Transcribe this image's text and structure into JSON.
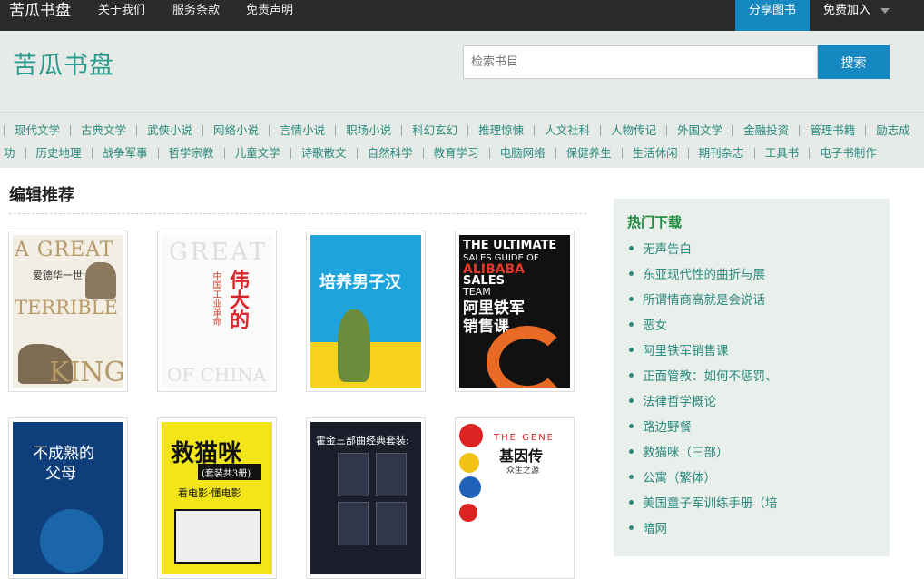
{
  "topbar": {
    "brand": "苦瓜书盘",
    "nav": [
      "关于我们",
      "服务条款",
      "免责声明"
    ],
    "share": "分享图书",
    "join": "免费加入"
  },
  "header": {
    "logo": "苦瓜书盘",
    "search_placeholder": "检索书目",
    "search_button": "搜索"
  },
  "categories_row1": [
    "现代文学",
    "古典文学",
    "武侠小说",
    "网络小说",
    "言情小说",
    "职场小说",
    "科幻玄幻",
    "推理惊悚",
    "人文社科",
    "人物传记",
    "外国文学",
    "金融投资",
    "管理书籍",
    "励志成"
  ],
  "categories_row2": [
    "功",
    "历史地理",
    "战争军事",
    "哲学宗教",
    "儿童文学",
    "诗歌散文",
    "自然科学",
    "教育学习",
    "电脑网络",
    "保健养生",
    "生活休闲",
    "期刊杂志",
    "工具书",
    "电子书制作"
  ],
  "recommend": {
    "title": "编辑推荐"
  },
  "covers": {
    "b1": {
      "t1": "A GREAT",
      "t2": "爱德华一世",
      "t3": "TERRIBLE",
      "t4": "KING"
    },
    "b2": {
      "t1": "GREAT",
      "t2": "伟大的",
      "t3": "中国工业革命",
      "t4": "OF CHINA"
    },
    "b3": {
      "t1": "培养男子汉"
    },
    "b4": {
      "t1": "THE ULTIMATE",
      "t2": "SALES GUIDE OF",
      "t3": "ALIBABA",
      "t4": "SALES",
      "t5": "TEAM",
      "t6": "阿里铁军",
      "t7": "销售课"
    },
    "b5": {
      "t1": "不成熟的",
      "t2": "父母"
    },
    "b6": {
      "t1": "救猫咪",
      "t2": "(套装共3册)",
      "t3": "看电影·懂电影"
    },
    "b7": {
      "t1": "霍金三部曲经典套装:"
    },
    "b8": {
      "t1": "THE GENE",
      "t2": "基因传",
      "t3": "众生之源"
    }
  },
  "hot": {
    "title": "热门下载",
    "items": [
      "无声告白",
      "东亚现代性的曲折与展",
      "所谓情商高就是会说话",
      "恶女",
      "阿里铁军销售课",
      "正面管教：如何不惩罚、",
      "法律哲学概论",
      "路边野餐",
      "救猫咪（三部）",
      "公寓（繁体）",
      "美国童子军训练手册（培",
      "暗网"
    ]
  }
}
